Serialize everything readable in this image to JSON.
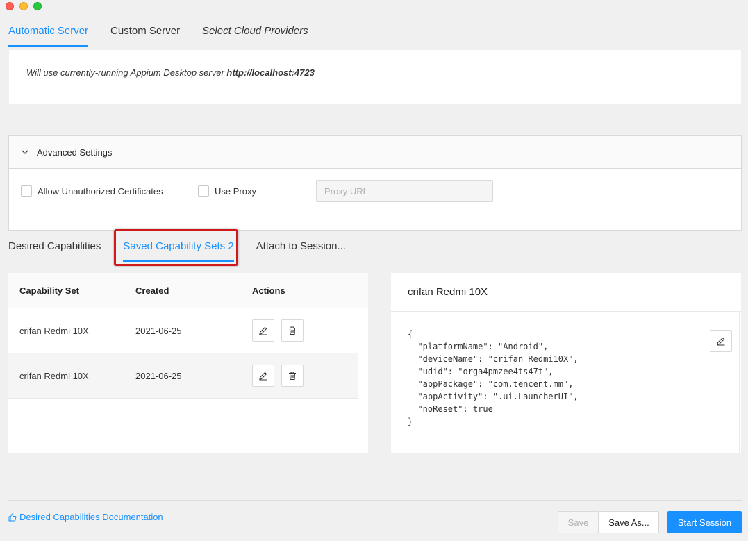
{
  "window": {
    "controls": [
      "close",
      "minimize",
      "zoom"
    ]
  },
  "server_tabs": {
    "automatic": "Automatic Server",
    "custom": "Custom Server",
    "cloud": "Select Cloud Providers"
  },
  "server_info": {
    "prefix": "Will use currently-running Appium Desktop server ",
    "url": "http://localhost:4723"
  },
  "advanced": {
    "title": "Advanced Settings",
    "allow_unauthorized": "Allow Unauthorized Certificates",
    "use_proxy": "Use Proxy",
    "proxy_placeholder": "Proxy URL"
  },
  "capability_tabs": {
    "desired": "Desired Capabilities",
    "saved": "Saved Capability Sets 2",
    "attach": "Attach to Session..."
  },
  "table": {
    "headers": [
      "Capability Set",
      "Created",
      "Actions"
    ],
    "rows": [
      {
        "name": "crifan Redmi 10X",
        "created": "2021-06-25"
      },
      {
        "name": "crifan Redmi 10X",
        "created": "2021-06-25"
      }
    ]
  },
  "detail": {
    "title": "crifan Redmi 10X",
    "json": "{\n  \"platformName\": \"Android\",\n  \"deviceName\": \"crifan Redmi10X\",\n  \"udid\": \"orga4pmzee4ts47t\",\n  \"appPackage\": \"com.tencent.mm\",\n  \"appActivity\": \".ui.LauncherUI\",\n  \"noReset\": true\n}"
  },
  "footer": {
    "doc_link": "Desired Capabilities Documentation",
    "save": "Save",
    "save_as": "Save As...",
    "start": "Start Session"
  },
  "colors": {
    "accent": "#1890ff",
    "highlight": "#d0191b"
  }
}
